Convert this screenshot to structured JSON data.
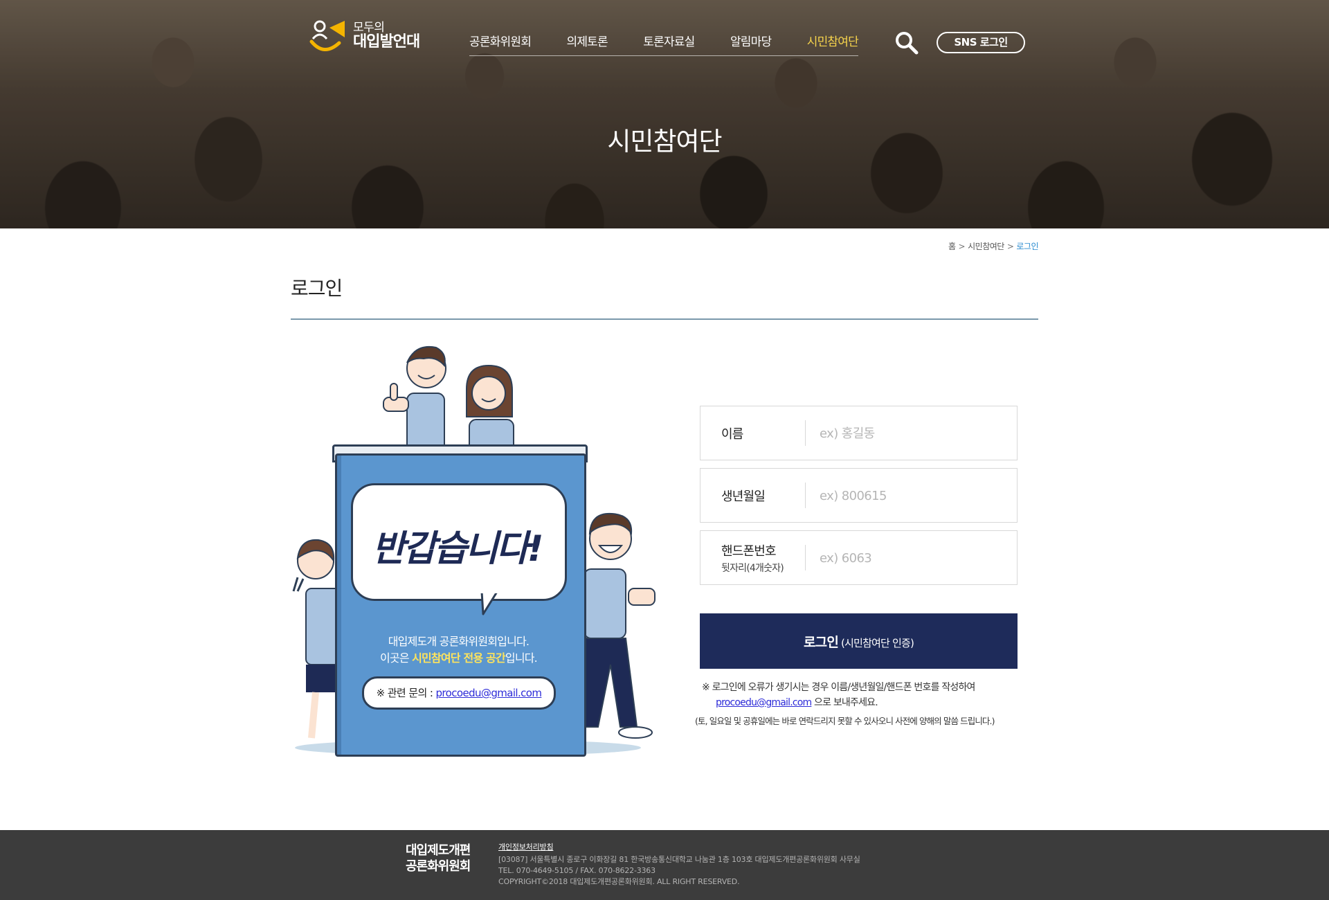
{
  "header": {
    "logo_small": "모두의",
    "logo_big": "대입발언대",
    "nav": [
      {
        "label": "공론화위원회",
        "active": false
      },
      {
        "label": "의제토론",
        "active": false
      },
      {
        "label": "토론자료실",
        "active": false
      },
      {
        "label": "알림마당",
        "active": false
      },
      {
        "label": "시민참여단",
        "active": true
      }
    ],
    "sns_login": "SNS 로그인",
    "accent_color": "#f7d44c"
  },
  "hero": {
    "title": "시민참여단"
  },
  "breadcrumb": {
    "home": "홈",
    "section": "시민참여단",
    "current": "로그인"
  },
  "page": {
    "title": "로그인"
  },
  "illustration": {
    "greeting": "반갑습니다!",
    "line1": "대입제도개 공론화위원회입니다.",
    "line2_prefix": "이곳은 ",
    "line2_highlight": "시민참여단 전용 공간",
    "line2_suffix": "입니다.",
    "contact_prefix": "※ 관련 문의 : ",
    "contact_email": "procoedu@gmail.com"
  },
  "form": {
    "name": {
      "label": "이름",
      "placeholder": "ex) 홍길동",
      "value": ""
    },
    "birth": {
      "label": "생년월일",
      "placeholder": "ex) 800615",
      "value": ""
    },
    "phone": {
      "label": "핸드폰번호",
      "sublabel": "뒷자리(4개숫자)",
      "placeholder": "ex) 6063",
      "value": ""
    },
    "login_button": "로그인",
    "login_button_sub": " (시민참여단 인증)",
    "notice_prefix": "※ 로그인에 오류가 생기시는 경우 이름/생년월일/핸드폰 번호를 작성하여",
    "notice_email": "procoedu@gmail.com",
    "notice_suffix": " 으로 보내주세요.",
    "notice2": "(토, 일요일 및 공휴일에는 바로 연락드리지 못할 수 있사오니 사전에 양해의 말씀 드립니다.)",
    "button_color": "#1e2b5a"
  },
  "footer": {
    "logo_line1": "대입제도개편",
    "logo_line2": "공론화위원회",
    "privacy": "개인정보처리방침",
    "address": "[03087] 서울특별시 종로구 이화장길 81 한국방송통신대학교 나눔관 1층 103호 대입제도개편공론화위원회 사무실",
    "tel": "TEL. 070-4649-5105 / FAX. 070-8622-3363",
    "copyright": "COPYRIGHT©2018 대입제도개편공론화위원회. ALL RIGHT RESERVED."
  }
}
